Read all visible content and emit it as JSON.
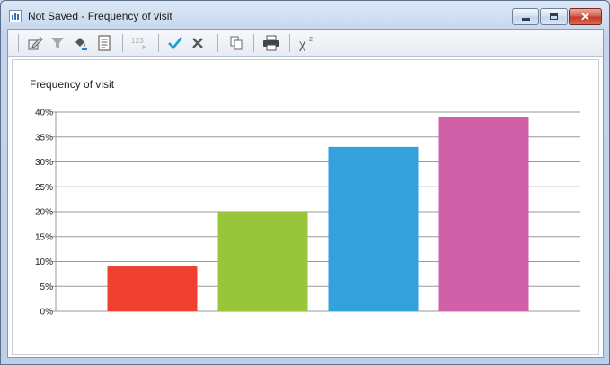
{
  "window": {
    "title": "Not Saved - Frequency of visit",
    "controls": {
      "minimize": "minimize",
      "maximize": "maximize",
      "close": "✕"
    }
  },
  "toolbar": {
    "items": [
      {
        "name": "edit-icon",
        "glyph": "✎"
      },
      {
        "name": "filter-icon",
        "glyph": "▼"
      },
      {
        "name": "paint-bucket-icon",
        "glyph": "◆"
      },
      {
        "name": "notes-icon",
        "glyph": "▤"
      },
      {
        "name": "number-format-icon",
        "glyph": "123"
      },
      {
        "name": "apply-check-icon",
        "glyph": "✔"
      },
      {
        "name": "cancel-x-icon",
        "glyph": "✖"
      },
      {
        "name": "copy-icon",
        "glyph": "❐"
      },
      {
        "name": "print-icon",
        "glyph": "▬"
      },
      {
        "name": "chi-square-icon",
        "glyph": "χ²"
      }
    ]
  },
  "chart_data": {
    "type": "bar",
    "title": "Frequency of visit",
    "categories": [
      "",
      "",
      "",
      ""
    ],
    "values": [
      9,
      20,
      33,
      39
    ],
    "colors": [
      "#f04030",
      "#98c53a",
      "#33a1dc",
      "#d060a8"
    ],
    "ylim": [
      0,
      40
    ],
    "yticks": [
      "0%",
      "5%",
      "10%",
      "15%",
      "20%",
      "25%",
      "30%",
      "35%",
      "40%"
    ],
    "grid": true,
    "legend": "none"
  }
}
